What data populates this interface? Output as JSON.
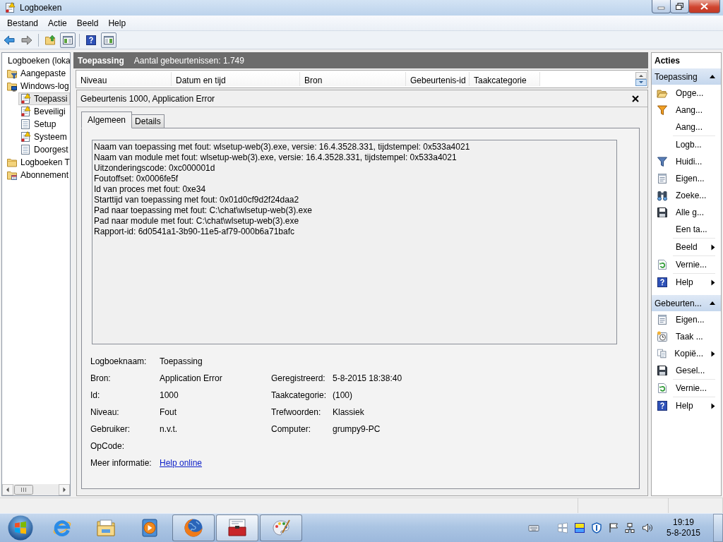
{
  "window": {
    "title": "Logboeken"
  },
  "menu": [
    "Bestand",
    "Actie",
    "Beeld",
    "Help"
  ],
  "toolbar": {
    "buttons": [
      {
        "pressed": false
      },
      {
        "pressed": false
      },
      {
        "pressed": false
      },
      {
        "pressed": true
      },
      {
        "pressed": false
      },
      {
        "pressed": true
      }
    ]
  },
  "tree": [
    {
      "label": "Logboeken (loka",
      "selected": false,
      "children": [
        {
          "label": "Aangepaste",
          "selected": false
        },
        {
          "label": "Windows-log",
          "selected": false,
          "children": [
            {
              "label": "Toepassi",
              "selected": true
            },
            {
              "label": "Beveiligi",
              "selected": false
            },
            {
              "label": "Setup",
              "selected": false
            },
            {
              "label": "Systeem",
              "selected": false
            },
            {
              "label": "Doorgest",
              "selected": false
            }
          ]
        },
        {
          "label": "Logboeken T",
          "selected": false
        },
        {
          "label": "Abonnement",
          "selected": false
        }
      ]
    }
  ],
  "header": {
    "title": "Toepassing",
    "count": "Aantal gebeurtenissen: 1.749"
  },
  "columns": [
    "Niveau",
    "Datum en tijd",
    "Bron",
    "Gebeurtenis-id",
    "Taakcategorie"
  ],
  "event": {
    "title": "Gebeurtenis 1000, Application Error",
    "tabs": [
      {
        "label": "Algemeen",
        "selected": true
      },
      {
        "label": "Details",
        "selected": false
      }
    ],
    "description": [
      "Naam van toepassing met fout: wlsetup-web(3).exe, versie: 16.4.3528.331, tijdstempel: 0x533a4021",
      "Naam van module met fout: wlsetup-web(3).exe, versie: 16.4.3528.331, tijdstempel: 0x533a4021",
      "Uitzonderingscode: 0xc000001d",
      "Foutoffset: 0x0006fe5f",
      "Id van proces met fout: 0xe34",
      "Starttijd van toepassing met fout: 0x01d0cf9d2f24daa2",
      "Pad naar toepassing met fout: C:\\chat\\wlsetup-web(3).exe",
      "Pad naar module met fout: C:\\chat\\wlsetup-web(3).exe",
      "Rapport-id: 6d0541a1-3b90-11e5-af79-000b6a71bafc"
    ],
    "properties": [
      {
        "left": {
          "label": "Logboeknaam:",
          "value": "Toepassing"
        }
      },
      {
        "left": {
          "label": "Bron:",
          "value": "Application Error"
        },
        "right": {
          "label": "Geregistreerd:",
          "value": "5-8-2015 18:38:40"
        }
      },
      {
        "left": {
          "label": "Id:",
          "value": "1000"
        },
        "right": {
          "label": "Taakcategorie:",
          "value": "(100)"
        }
      },
      {
        "left": {
          "label": "Niveau:",
          "value": "Fout"
        },
        "right": {
          "label": "Trefwoorden:",
          "value": "Klassiek"
        }
      },
      {
        "left": {
          "label": "Gebruiker:",
          "value": "n.v.t."
        },
        "right": {
          "label": "Computer:",
          "value": "grumpy9-PC"
        }
      },
      {
        "left": {
          "label": "OpCode:"
        }
      },
      {
        "left": {
          "label": "Meer informatie:",
          "link": "Help online"
        }
      }
    ]
  },
  "actions": {
    "title": "Acties",
    "sections": [
      {
        "title": "Toepassing",
        "expanded": true,
        "groups": [
          [
            {
              "label": "Opge...",
              "submenu": false
            },
            {
              "label": "Aang...",
              "submenu": false
            },
            {
              "label": "Aang...",
              "submenu": false
            }
          ],
          [
            {
              "label": "Logb...",
              "submenu": false
            },
            {
              "label": "Huidi...",
              "submenu": false
            },
            {
              "label": "Eigen...",
              "submenu": false
            },
            {
              "label": "Zoeke...",
              "submenu": false
            },
            {
              "label": "Alle g...",
              "submenu": false
            },
            {
              "label": "Een ta...",
              "submenu": false
            }
          ],
          [
            {
              "label": "Beeld",
              "submenu": true
            }
          ],
          [
            {
              "label": "Vernie...",
              "submenu": false
            }
          ],
          [
            {
              "label": "Help",
              "submenu": true
            }
          ]
        ]
      },
      {
        "title": "Gebeurten...",
        "expanded": true,
        "groups": [
          [
            {
              "label": "Eigen...",
              "submenu": false
            },
            {
              "label": "Taak ...",
              "submenu": false
            },
            {
              "label": "Kopië...",
              "submenu": true
            },
            {
              "label": "Gesel...",
              "submenu": false
            }
          ],
          [
            {
              "label": "Vernie...",
              "submenu": false
            }
          ],
          [
            {
              "label": "Help",
              "submenu": true
            }
          ]
        ]
      }
    ]
  },
  "taskbar": {
    "apps": [
      {
        "running": false,
        "selected": false
      },
      {
        "running": false,
        "selected": false
      },
      {
        "running": false,
        "selected": false
      },
      {
        "running": true,
        "selected": false
      },
      {
        "running": true,
        "selected": true
      },
      {
        "running": true,
        "selected": false
      }
    ],
    "clock": {
      "time": "19:19",
      "date": "5-8-2015"
    }
  }
}
